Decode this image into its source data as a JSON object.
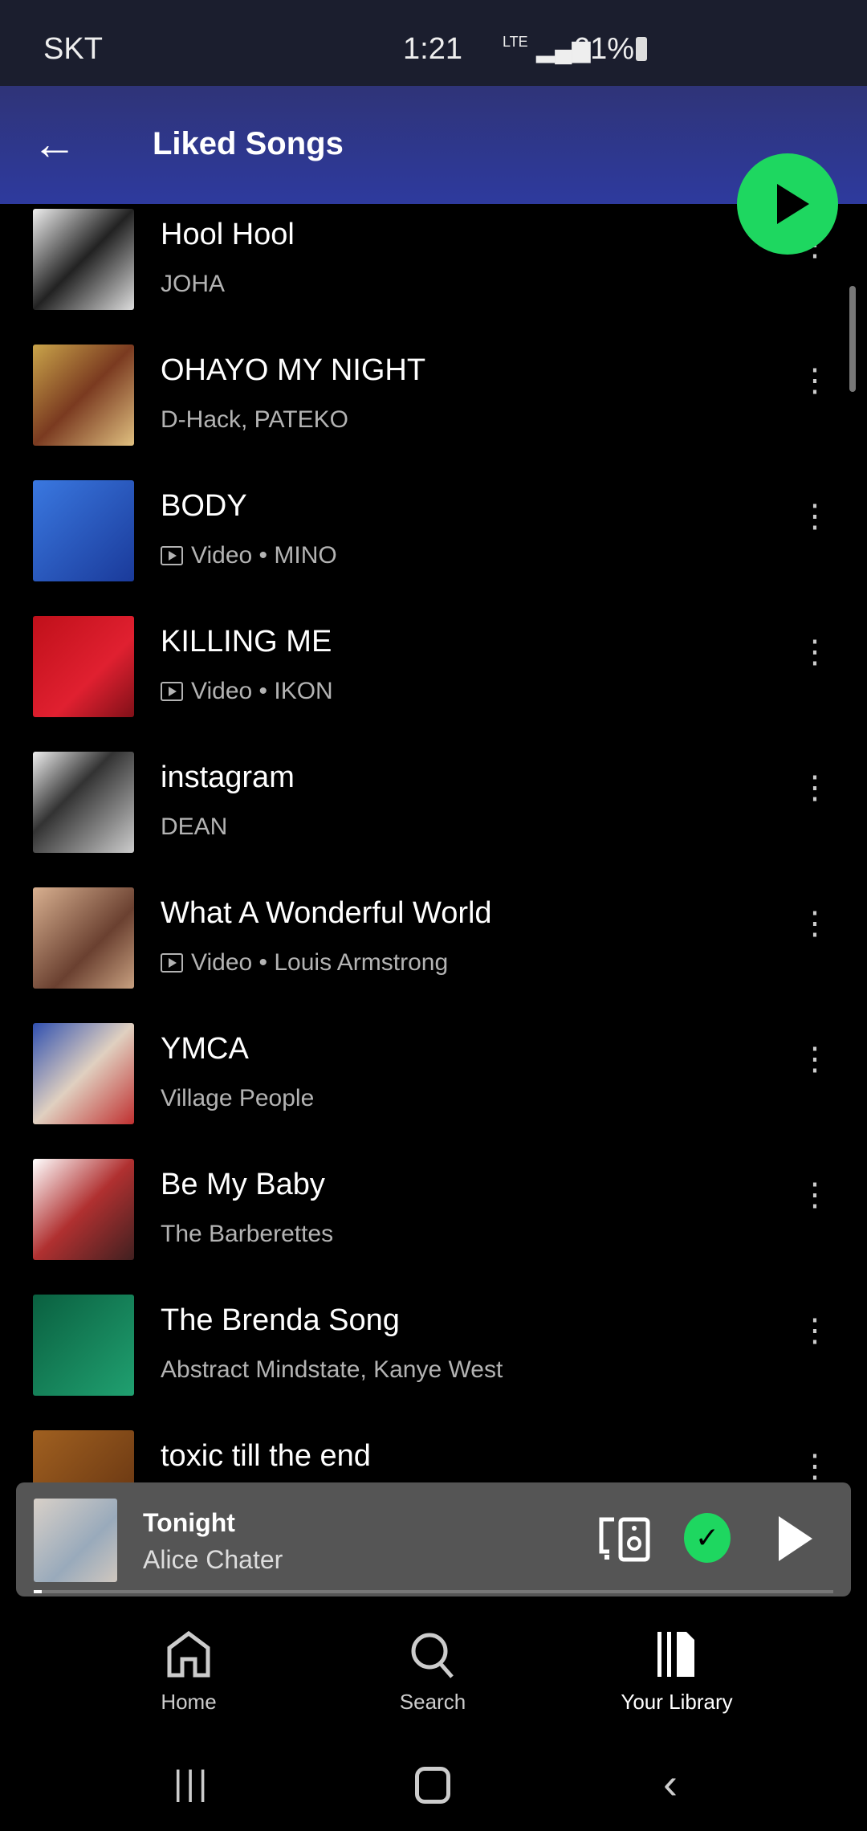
{
  "status": {
    "carrier": "SKT",
    "time": "1:21",
    "network": "LTE",
    "battery": "61%"
  },
  "header": {
    "title": "Liked Songs"
  },
  "songs": [
    {
      "title": "Hool Hool",
      "subtitle": "JOHA",
      "video": false,
      "art": "linear-gradient(135deg,#eee,#222 50%,#ddd)"
    },
    {
      "title": "OHAYO MY NIGHT",
      "subtitle": "D-Hack, PATEKO",
      "video": false,
      "art": "linear-gradient(135deg,#c9a44a,#7a3a20 50%,#e0c080)"
    },
    {
      "title": "BODY",
      "subtitle": "MINO",
      "video": true,
      "video_label": "Video",
      "art": "linear-gradient(135deg,#3a78e0,#1a3a9a)"
    },
    {
      "title": "KILLING ME",
      "subtitle": "IKON",
      "video": true,
      "video_label": "Video",
      "art": "linear-gradient(135deg,#c0101a,#e02030 60%,#801018)"
    },
    {
      "title": "instagram",
      "subtitle": "DEAN",
      "video": false,
      "art": "linear-gradient(135deg,#eee,#333 40%,#ccc)"
    },
    {
      "title": "What A Wonderful World",
      "subtitle": "Louis Armstrong",
      "video": true,
      "video_label": "Video",
      "art": "linear-gradient(135deg,#d8b090,#6a4030 60%,#c8a080)"
    },
    {
      "title": "YMCA",
      "subtitle": "Village People",
      "video": false,
      "art": "linear-gradient(135deg,#3050b0,#e0d0c0 50%,#c03030)"
    },
    {
      "title": "Be My Baby",
      "subtitle": "The Barberettes",
      "video": false,
      "art": "linear-gradient(135deg,#fff,#b03030 50%,#402020)"
    },
    {
      "title": "The Brenda Song",
      "subtitle": "Abstract Mindstate, Kanye West",
      "video": false,
      "art": "linear-gradient(135deg,#0a6040,#20a070)"
    },
    {
      "title": "toxic till the end",
      "subtitle": "",
      "video": false,
      "art": "linear-gradient(135deg,#a06020,#603010)"
    }
  ],
  "mini_player": {
    "title": "Tonight",
    "artist": "Alice Chater",
    "progress": 0.01,
    "liked": true
  },
  "nav": {
    "home": "Home",
    "search": "Search",
    "library": "Your Library",
    "active": "library"
  },
  "colors": {
    "accent": "#1ed760",
    "header": "#2e3a9e"
  }
}
